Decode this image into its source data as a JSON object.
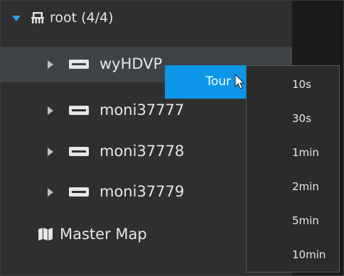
{
  "tree": {
    "root": {
      "label": "root (4/4)",
      "expanded": true,
      "icon": "organization-icon"
    },
    "devices": [
      {
        "label": "wyHDVP",
        "selected": true,
        "icon": "device-icon"
      },
      {
        "label": "moni37777",
        "selected": false,
        "icon": "device-icon"
      },
      {
        "label": "moni37778",
        "selected": false,
        "icon": "device-icon"
      },
      {
        "label": "moni37779",
        "selected": false,
        "icon": "device-icon"
      }
    ],
    "map": {
      "label": "Master Map",
      "icon": "map-icon"
    }
  },
  "context_menu": {
    "tour_label": "Tour",
    "intervals": [
      "10s",
      "30s",
      "1min",
      "2min",
      "5min",
      "10min"
    ]
  },
  "colors": {
    "accent": "#0b96e8",
    "expand_arrow": "#29a3ef",
    "panel_bg": "#2f2f2f",
    "selected_row_bg": "#3f4247"
  }
}
